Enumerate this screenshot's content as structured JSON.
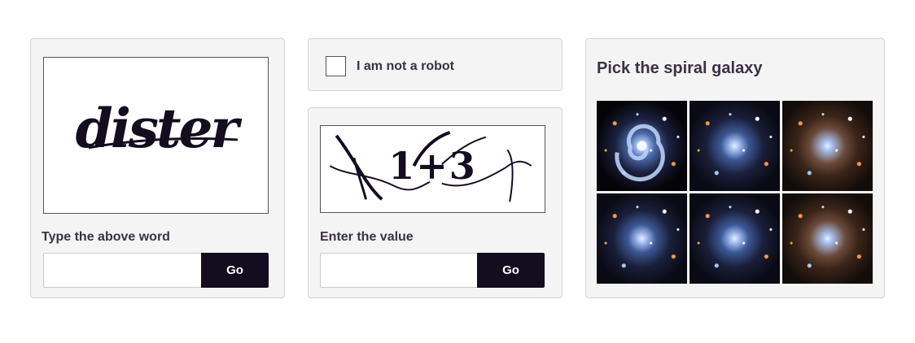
{
  "word_captcha": {
    "image_text": "dister",
    "prompt": "Type the above word",
    "input_value": "",
    "button_label": "Go"
  },
  "robot_check": {
    "label": "I am not a robot",
    "checked": false
  },
  "math_captcha": {
    "image_text": "1+3",
    "prompt": "Enter the value",
    "input_value": "",
    "button_label": "Go"
  },
  "image_captcha": {
    "title": "Pick the spiral galaxy",
    "tiles": [
      {
        "content": "spiral-galaxy"
      },
      {
        "content": "irregular-galaxy"
      },
      {
        "content": "dense-star-cluster"
      },
      {
        "content": "irregular-galaxy"
      },
      {
        "content": "irregular-galaxy"
      },
      {
        "content": "dense-star-cluster"
      }
    ]
  },
  "colors": {
    "panel_bg": "#f4f4f4",
    "button_bg": "#140c1f",
    "text": "#3b3146"
  }
}
